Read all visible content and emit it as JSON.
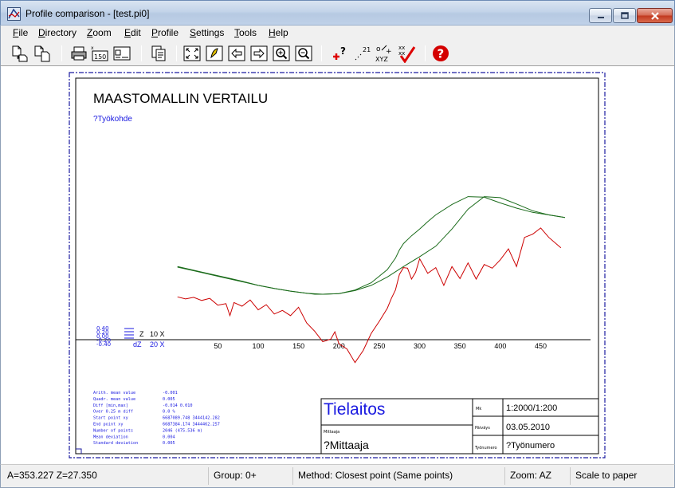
{
  "window": {
    "title": "Profile comparison - [test.pi0]"
  },
  "menu": [
    {
      "label": "File",
      "key": "F",
      "rest": "ile"
    },
    {
      "label": "Directory",
      "key": "D",
      "rest": "irectory"
    },
    {
      "label": "Zoom",
      "key": "Z",
      "rest": "oom"
    },
    {
      "label": "Edit",
      "key": "E",
      "rest": "dit"
    },
    {
      "label": "Profile",
      "key": "P",
      "rest": "rofile"
    },
    {
      "label": "Settings",
      "key": "S",
      "rest": "ettings"
    },
    {
      "label": "Tools",
      "key": "T",
      "rest": "ools"
    },
    {
      "label": "Help",
      "key": "H",
      "rest": "elp"
    }
  ],
  "toolbar": {
    "scale_icon_label": "150",
    "power_icon_label": "21",
    "xyz_icon_label": "XYZ"
  },
  "drawing": {
    "title": "MAASTOMALLIN VERTAILU",
    "subtitle": "?Työkohde",
    "legend": [
      {
        "symbol": "Z",
        "text": "10 X"
      },
      {
        "symbol": "dZ",
        "text": "20 X"
      }
    ],
    "stats": [
      {
        "label": "Arith. mean value",
        "value": "-0.001"
      },
      {
        "label": "Quadr. mean value",
        "value": "0.005"
      },
      {
        "label": "Diff [min,max]",
        "value": "-0.014     0.010"
      },
      {
        "label": "Over  0.25 m diff",
        "value": "0.0 %"
      },
      {
        "label": "Start point xy",
        "value": "6687089.748 3444142.282"
      },
      {
        "label": "End point   xy",
        "value": "6687384.174 3444462.257"
      },
      {
        "label": "Number of points",
        "value": "2046   (475.536 m)"
      },
      {
        "label": "Mean deviation",
        "value": "0.004"
      },
      {
        "label": "Standard deviation",
        "value": "0.005"
      }
    ],
    "titleblock": {
      "company": "Tielaitos",
      "mk_label": "Mk",
      "mk_value": "1:2000/1:200",
      "mittaaja_label": "Mittaaja",
      "mittaaja_value": "?Mittaaja",
      "paivays_label": "Päiväys",
      "paivays_value": "03.05.2010",
      "tyonumero_label": "Työnumero",
      "tyonumero_value": "?Työnumero"
    }
  },
  "chart_data": {
    "type": "line",
    "title": "MAASTOMALLIN VERTAILU",
    "xlabel": "",
    "ylabel": "",
    "xlim": [
      -55,
      490
    ],
    "ylim": [
      27.0,
      30.5
    ],
    "grid": false,
    "x_ticks": [
      50,
      100,
      150,
      200,
      250,
      300,
      350,
      400,
      450
    ],
    "series": [
      {
        "color": "#1a6b1a",
        "x": [
          0,
          20,
          40,
          60,
          80,
          100,
          120,
          140,
          160,
          170,
          180,
          200,
          220,
          240,
          260,
          280,
          300,
          320,
          340,
          360,
          380,
          400,
          420,
          440,
          460,
          480
        ],
        "y": [
          28.85,
          28.78,
          28.71,
          28.64,
          28.57,
          28.5,
          28.44,
          28.39,
          28.35,
          28.33,
          28.33,
          28.34,
          28.4,
          28.5,
          28.66,
          28.86,
          29.05,
          29.25,
          29.58,
          29.96,
          30.2,
          30.18,
          30.06,
          29.93,
          29.85,
          29.8
        ]
      },
      {
        "color": "#1a6b1a",
        "x": [
          0,
          20,
          40,
          60,
          80,
          100,
          120,
          140,
          160,
          180,
          200,
          220,
          240,
          260,
          270,
          275,
          280,
          290,
          300,
          310,
          320,
          340,
          360,
          380,
          400,
          420,
          440,
          460,
          480
        ],
        "y": [
          28.86,
          28.79,
          28.72,
          28.65,
          28.58,
          28.5,
          28.44,
          28.39,
          28.35,
          28.33,
          28.34,
          28.41,
          28.55,
          28.8,
          29.02,
          29.18,
          29.3,
          29.45,
          29.58,
          29.72,
          29.85,
          30.05,
          30.2,
          30.19,
          30.08,
          29.98,
          29.9,
          29.85,
          29.8
        ]
      },
      {
        "color": "#cc0000",
        "x": [
          0,
          10,
          20,
          30,
          40,
          50,
          60,
          65,
          70,
          80,
          90,
          100,
          110,
          120,
          130,
          140,
          150,
          160,
          170,
          180,
          190,
          195,
          200,
          210,
          220,
          230,
          240,
          250,
          260,
          265,
          270,
          275,
          280,
          285,
          290,
          295,
          300,
          310,
          320,
          330,
          340,
          350,
          360,
          370,
          380,
          390,
          400,
          410,
          420,
          430,
          440,
          450,
          460,
          475
        ],
        "y": [
          28.28,
          28.24,
          28.27,
          28.21,
          28.25,
          28.12,
          28.15,
          27.92,
          28.17,
          28.1,
          28.22,
          28.03,
          28.13,
          27.95,
          28.02,
          27.92,
          28.08,
          27.78,
          27.62,
          27.42,
          27.47,
          27.61,
          27.38,
          27.28,
          27.02,
          27.25,
          27.58,
          27.81,
          28.06,
          28.25,
          28.41,
          28.71,
          28.84,
          28.83,
          28.62,
          28.75,
          29.01,
          28.73,
          28.84,
          28.5,
          28.86,
          28.63,
          28.93,
          28.62,
          28.9,
          28.83,
          28.99,
          29.2,
          28.86,
          29.42,
          29.48,
          29.6,
          29.42,
          29.22
        ]
      }
    ]
  },
  "status": {
    "coords": "A=353.227  Z=27.350",
    "group": "Group: 0+",
    "method": "Method: Closest point (Same points)",
    "zoom": "Zoom: AZ",
    "scale": "Scale to paper"
  }
}
